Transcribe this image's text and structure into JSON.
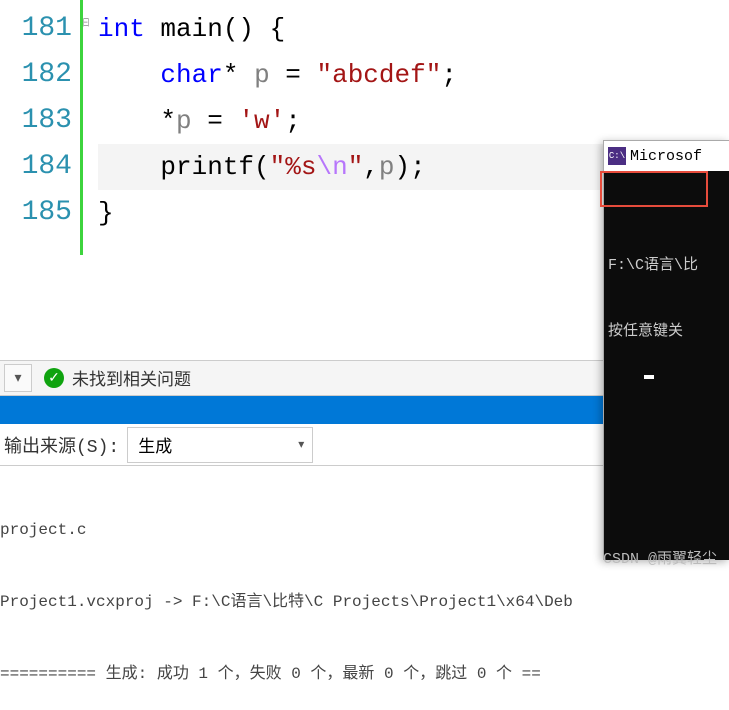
{
  "editor": {
    "lineNumbers": [
      "181",
      "182",
      "183",
      "184",
      "185"
    ],
    "lines": {
      "l181": {
        "kw": "int",
        "fn": " main",
        "rest": "() {"
      },
      "l182": {
        "kw": "char",
        "star": "* ",
        "ident": "p",
        "eq": " = ",
        "str": "\"abcdef\"",
        "semi": ";"
      },
      "l183": {
        "pre": "*",
        "ident": "p",
        "eq": " = ",
        "str": "'w'",
        "semi": ";"
      },
      "l184": {
        "fn": "printf",
        "open": "(",
        "str1": "\"%s",
        "esc": "\\n",
        "str2": "\"",
        "comma": ",",
        "ident": "p",
        "close": ");"
      },
      "l185": {
        "brace": "}"
      }
    }
  },
  "status": {
    "message": "未找到相关问题"
  },
  "output": {
    "label": "﻿输出来源(S):",
    "selectValue": "生成",
    "lines": [
      "﻿project.c",
      "Project1.vcxproj -> F:\\C语言\\比特\\C Projects\\Project1\\x64\\Deb",
      "========== 生成: 成功 1 个，失败 0 个，最新 0 个，跳过 0 个 =="
    ]
  },
  "console": {
    "iconText": "C:\\",
    "title": "Microsof",
    "line1": "F:\\C语言\\比",
    "line2": "按任意键关"
  },
  "watermark": "CSDN @雨翼轻尘"
}
